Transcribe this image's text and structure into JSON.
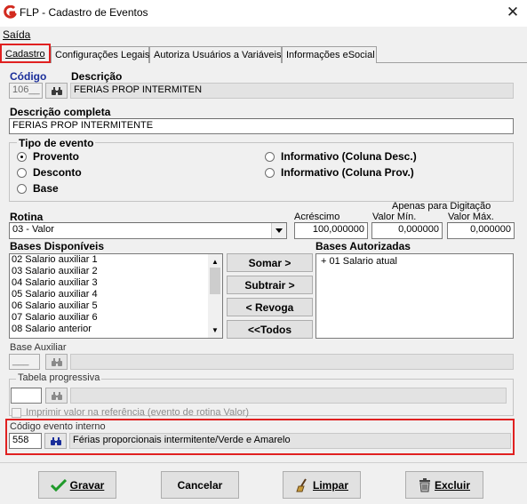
{
  "window": {
    "title": "FLP - Cadastro de Eventos"
  },
  "menu": {
    "items": [
      "Saída"
    ]
  },
  "tabs": [
    {
      "label": "Cadastro",
      "active": true
    },
    {
      "label": "Configurações Legais",
      "active": false
    },
    {
      "label": "Autoriza Usuários a Variáveis",
      "active": false
    },
    {
      "label": "Informações eSocial",
      "active": false
    }
  ],
  "form": {
    "codigo_label": "Código",
    "codigo_value": "106__",
    "descricao_label": "Descrição",
    "descricao_value": "FERIAS PROP INTERMITEN",
    "descricao_completa_label": "Descrição completa",
    "descricao_completa_value": "FERIAS PROP INTERMITENTE",
    "tipo_evento": {
      "title": "Tipo de evento",
      "options": [
        {
          "label": "Provento",
          "selected": true
        },
        {
          "label": "Desconto",
          "selected": false
        },
        {
          "label": "Base",
          "selected": false
        },
        {
          "label": "Informativo (Coluna Desc.)",
          "selected": false
        },
        {
          "label": "Informativo (Coluna Prov.)",
          "selected": false
        }
      ]
    },
    "rotina_label": "Rotina",
    "rotina_value": "03 - Valor",
    "acrescimo_label": "Acréscimo",
    "acrescimo_value": "100,000000",
    "apenas_label": "Apenas para Digitação",
    "valor_min_label": "Valor Mín.",
    "valor_min_value": "0,000000",
    "valor_max_label": "Valor Máx.",
    "valor_max_value": "0,000000",
    "bases_disponiveis_label": "Bases Disponíveis",
    "bases_disponiveis": [
      "02 Salario auxiliar 1",
      "03 Salario auxiliar 2",
      "04 Salario auxiliar 3",
      "05 Salario auxiliar 4",
      "06 Salario auxiliar 5",
      "07 Salario auxiliar 6",
      "08 Salario anterior"
    ],
    "bases_autorizadas_label": "Bases Autorizadas",
    "bases_autorizadas": [
      "+ 01 Salario atual"
    ],
    "somar_label": "Somar >",
    "subtrair_label": "Subtrair >",
    "revoga_label": "< Revoga",
    "todos_label": "<<Todos",
    "base_auxiliar_label": "Base Auxiliar",
    "base_auxiliar_code": "___",
    "tabela_progressiva_label": "Tabela progressiva",
    "tabela_progressiva_code": "",
    "imprimir_label": "Imprimir valor na referência (evento de rotina Valor)",
    "codigo_interno_label": "Código evento interno",
    "codigo_interno_value": "558",
    "codigo_interno_desc": "Férias proporcionais intermitente/Verde e Amarelo"
  },
  "buttons": {
    "gravar": "Gravar",
    "cancelar": "Cancelar",
    "limpar": "Limpar",
    "excluir": "Excluir"
  },
  "icons": {
    "app": "flp-logo-icon",
    "search": "binoculars-icon",
    "gravar": "checkmark-icon",
    "limpar": "broom-icon",
    "excluir": "trash-icon"
  },
  "colors": {
    "highlight": "#e02020",
    "label_blue": "#1a2e9a"
  }
}
